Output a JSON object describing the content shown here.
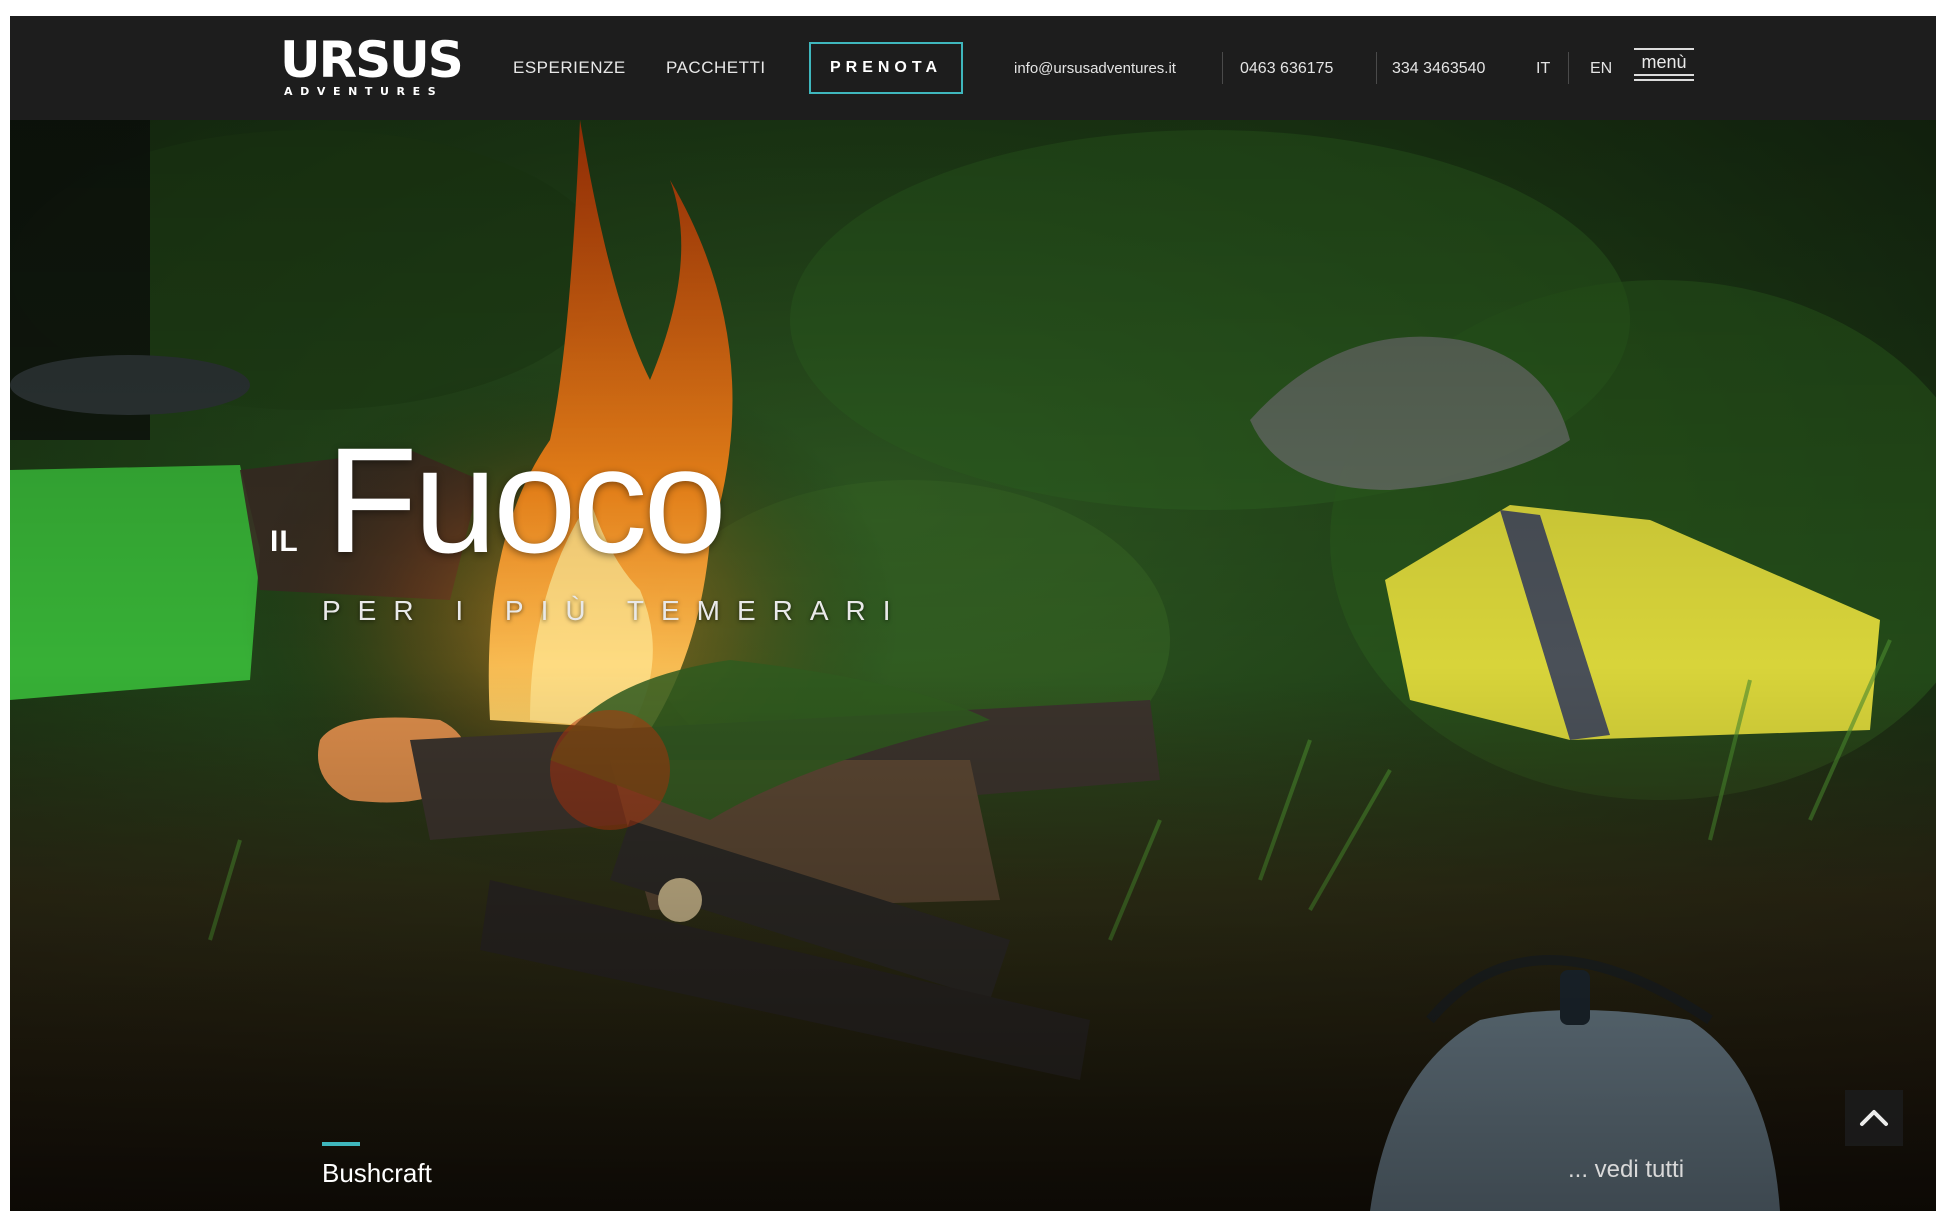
{
  "header": {
    "logo_text": "URSUS",
    "logo_subtitle": "ADVENTURES",
    "nav": {
      "esperienze": "ESPERIENZE",
      "pacchetti": "PACCHETTI",
      "prenota": "PRENOTA"
    },
    "contacts": {
      "email": "info@ursusadventures.it",
      "phone": "0463 636175",
      "mobile": "334 3463540"
    },
    "languages": {
      "it": "IT",
      "en": "EN"
    },
    "menu_label": "menù"
  },
  "hero": {
    "title_prefix": "IL",
    "title": "Fuoco",
    "subtitle": "PER I PIÙ TEMERARI",
    "category": "Bushcraft",
    "see_all": "... vedi tutti"
  },
  "colors": {
    "topbar": "#1d1d1d",
    "accent": "#3fb7bd",
    "text": "#ffffff"
  },
  "icons": {
    "back_to_top": "chevron-up-icon",
    "menu": "hamburger-menu-icon"
  }
}
